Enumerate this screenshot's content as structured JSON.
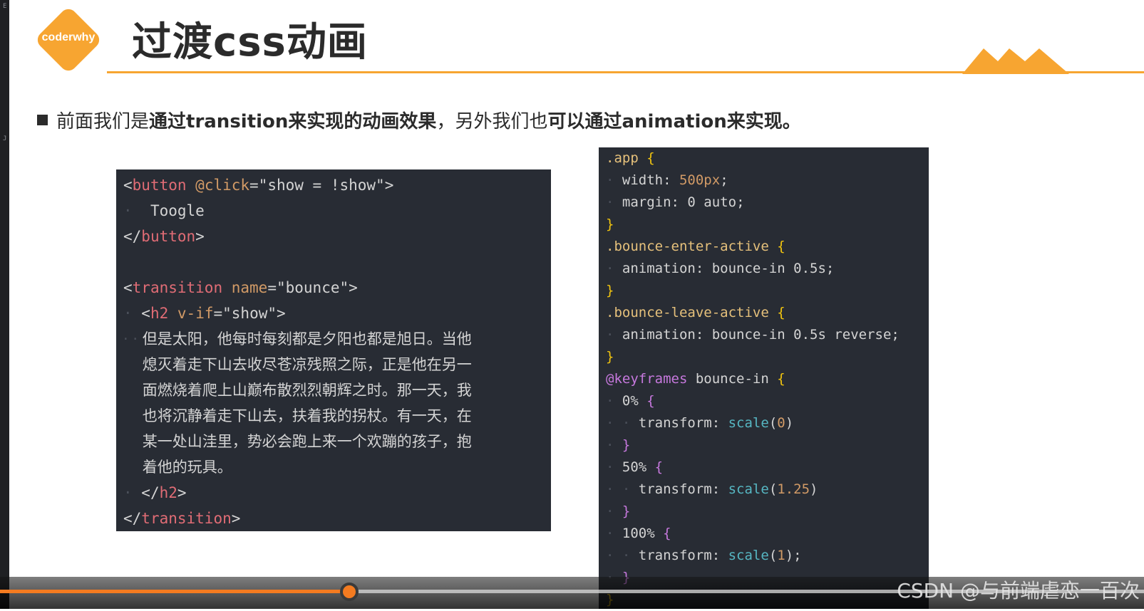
{
  "header": {
    "logo_text": "coderwhy",
    "title": "过渡css动画"
  },
  "bullet": {
    "part1": "前面我们是",
    "bold1": "通过transition来实现的动画效果",
    "part2": "，另外我们也",
    "bold2": "可以通过animation来实现。"
  },
  "template_code": {
    "btn_attr": "@click",
    "btn_value": "\"show = !show\"",
    "btn_text": "Toogle",
    "transition_attr": "name",
    "transition_value": "\"bounce\"",
    "h2_attr": "v-if",
    "h2_value": "\"show\"",
    "prose_lines": [
      "但是太阳，他每时每刻都是夕阳也都是旭日。当他",
      "熄灭着走下山去收尽苍凉残照之际，正是他在另一",
      "面燃烧着爬上山巅布散烈烈朝辉之时。那一天，我",
      "也将沉静着走下山去，扶着我的拐杖。有一天，在",
      "某一处山洼里，势必会跑上来一个欢蹦的孩子，抱",
      "着他的玩具。"
    ]
  },
  "css_code": {
    "sel_app": ".app",
    "app_width_val": "500px",
    "app_margin_val": "0 auto",
    "sel_enter": ".bounce-enter-active",
    "enter_anim": "bounce-in 0.5s",
    "sel_leave": ".bounce-leave-active",
    "leave_anim": "bounce-in 0.5s reverse",
    "keyframes_name": "bounce-in",
    "kf0": "0%",
    "kf0_val": "0",
    "kf50": "50%",
    "kf50_val": "1.25",
    "kf100": "100%",
    "kf100_val": "1"
  },
  "player": {
    "progress": 0.305,
    "watermark": "CSDN @与前端虐恋一百次"
  },
  "colors": {
    "accent": "#f7a531",
    "progress": "#f47b20",
    "code_bg": "#282c34"
  }
}
